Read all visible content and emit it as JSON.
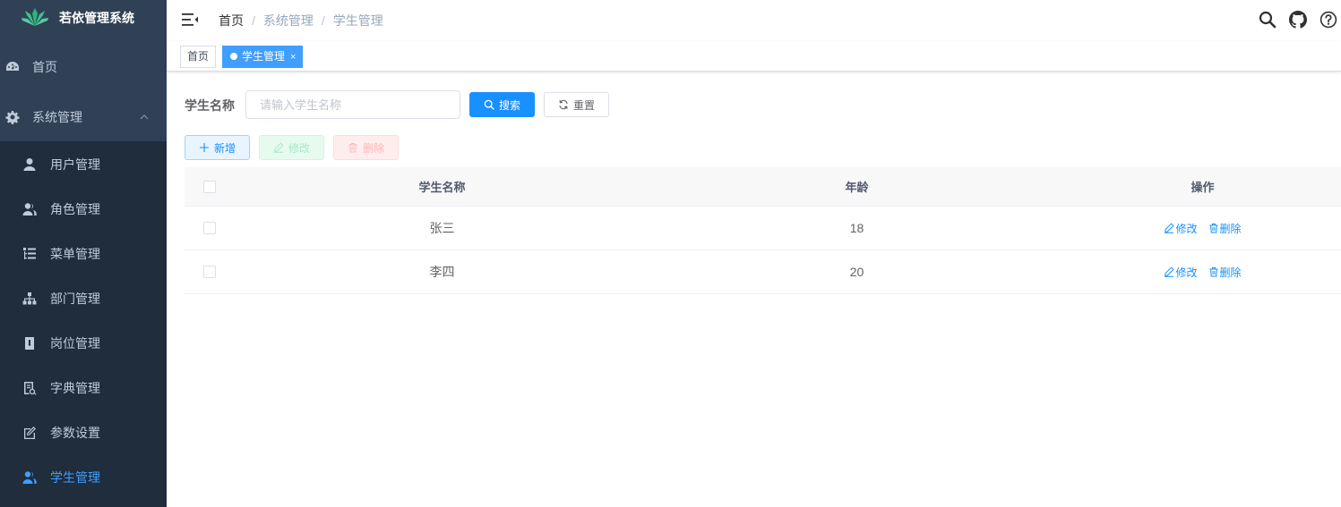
{
  "app": {
    "title": "若依管理系统"
  },
  "sidebar": {
    "items": [
      {
        "label": "首页",
        "icon": "dashboard-icon"
      },
      {
        "label": "系统管理",
        "icon": "gear-icon",
        "expanded": true
      }
    ],
    "sub_items": [
      {
        "label": "用户管理",
        "icon": "user-icon"
      },
      {
        "label": "角色管理",
        "icon": "peoples-icon"
      },
      {
        "label": "菜单管理",
        "icon": "tree-table-icon"
      },
      {
        "label": "部门管理",
        "icon": "tree-icon"
      },
      {
        "label": "岗位管理",
        "icon": "post-icon"
      },
      {
        "label": "字典管理",
        "icon": "dict-icon"
      },
      {
        "label": "参数设置",
        "icon": "edit-icon"
      },
      {
        "label": "学生管理",
        "icon": "peoples-icon",
        "active": true
      }
    ]
  },
  "navbar": {
    "breadcrumb": [
      "首页",
      "系统管理",
      "学生管理"
    ],
    "separator": "/"
  },
  "tags": [
    {
      "label": "首页",
      "active": false
    },
    {
      "label": "学生管理",
      "active": true,
      "close": "×"
    }
  ],
  "query": {
    "label": "学生名称",
    "placeholder": "请输入学生名称",
    "value": "",
    "search_label": "搜索",
    "reset_label": "重置"
  },
  "toolbar": {
    "add_label": "新增",
    "edit_label": "修改",
    "delete_label": "删除"
  },
  "table": {
    "columns": [
      "学生名称",
      "年龄",
      "操作"
    ],
    "rows": [
      {
        "name": "张三",
        "age": "18"
      },
      {
        "name": "李四",
        "age": "20"
      }
    ],
    "row_actions": {
      "edit": "修改",
      "delete": "删除"
    }
  },
  "colors": {
    "sidebar_bg": "#304156",
    "submenu_bg": "#1f2d3d",
    "primary": "#1890ff",
    "active_menu": "#409eff"
  }
}
